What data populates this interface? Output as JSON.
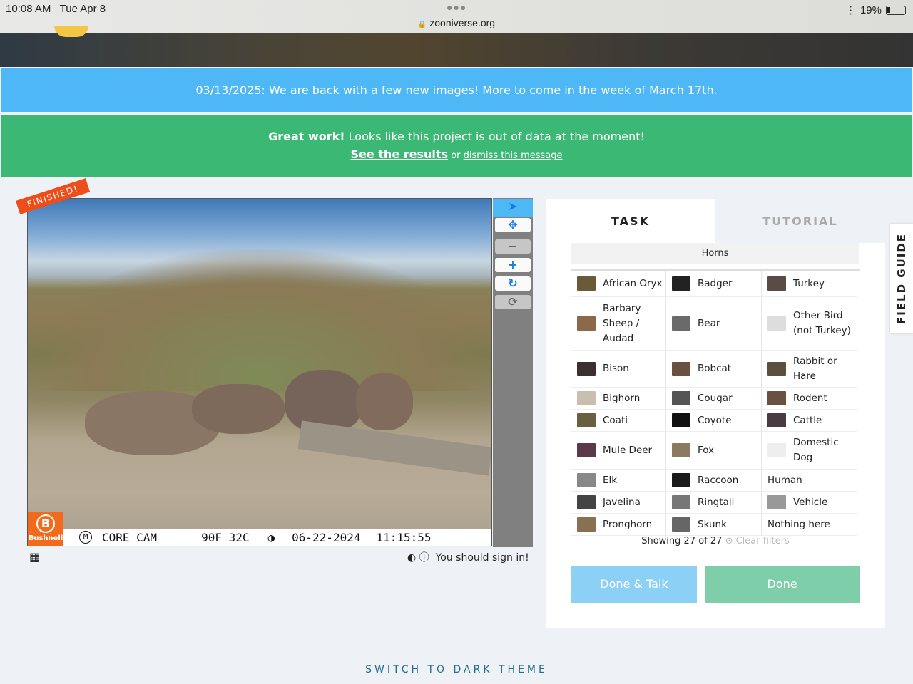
{
  "status_bar": {
    "time": "10:08 AM",
    "date": "Tue Apr 8",
    "url": "zooniverse.org",
    "battery": "19%"
  },
  "banners": {
    "info": "03/13/2025: We are back with a few new images! More to come in the week of March 17th.",
    "finished_bold": "Great work!",
    "finished_text": " Looks like this project is out of data at the moment!",
    "see_results": "See the results",
    "or": " or ",
    "dismiss": "dismiss this message"
  },
  "subject": {
    "badge": "FINISHED!",
    "brand": "Bushnell",
    "cam_mode": "M",
    "cam_name": "CORE_CAM",
    "temp": "90F 32C",
    "date": "06-22-2024",
    "time": "11:15:55",
    "sign_in": "You should sign in!"
  },
  "panel": {
    "tabs": [
      "TASK",
      "TUTORIAL"
    ],
    "filter": "Horns",
    "choices": [
      "African Oryx",
      "Badger",
      "Turkey",
      "Barbary Sheep / Audad",
      "Bear",
      "Other Bird (not Turkey)",
      "Bison",
      "Bobcat",
      "Rabbit or Hare",
      "Bighorn",
      "Cougar",
      "Rodent",
      "Coati",
      "Coyote",
      "Cattle",
      "Mule Deer",
      "Fox",
      "Domestic Dog",
      "Elk",
      "Raccoon",
      "Human",
      "Javelina",
      "Ringtail",
      "Vehicle",
      "Pronghorn",
      "Skunk",
      "Nothing here"
    ],
    "showing": "Showing 27 of 27",
    "clear_filters": "Clear filters",
    "done_talk": "Done & Talk",
    "done": "Done"
  },
  "field_guide": "FIELD GUIDE",
  "footer": {
    "dark_theme": "SWITCH TO DARK THEME"
  },
  "colors": {
    "info": "#4db8f5",
    "success": "#3bb974",
    "done_talk": "#8dd0f5",
    "done": "#7fceaa"
  }
}
